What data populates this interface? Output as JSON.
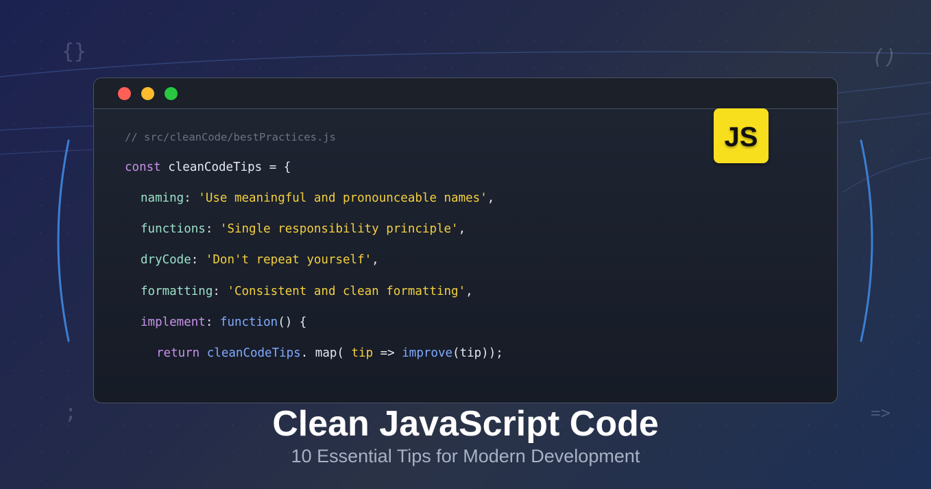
{
  "decorations": {
    "braces": "{}",
    "parens": "()",
    "semicolon": ";",
    "arrow": "=>"
  },
  "window": {
    "controls": [
      "close",
      "minimize",
      "maximize"
    ],
    "badge": "JS",
    "code": {
      "comment": "// src/cleanCode/bestPractices.js",
      "line1": {
        "kw": "const",
        "rest": " cleanCodeTips = {"
      },
      "naming": {
        "key": "naming",
        "sep": ": ",
        "value": "'Use meaningful and pronounceable names'",
        "end": ","
      },
      "functions": {
        "key": "functions",
        "sep": ": ",
        "value": "'Single responsibility principle'",
        "end": ","
      },
      "dryCode": {
        "key": "dryCode",
        "sep": ": ",
        "value": "'Don't repeat yourself'",
        "end": ","
      },
      "formatting": {
        "key": "formatting",
        "sep": ": ",
        "value": "'Consistent and clean formatting'",
        "end": ","
      },
      "implement": {
        "key": "implement",
        "sep": ": ",
        "fn": "function",
        "end": "() {"
      },
      "returnLine": {
        "kw": "return",
        "obj": "cleanCodeTips",
        "dot": ". map( ",
        "param": "tip",
        "arrow": " => ",
        "call": "improve",
        "end": "(tip));"
      }
    }
  },
  "heading": {
    "title": "Clean JavaScript Code",
    "subtitle": "10 Essential Tips for Modern Development"
  },
  "colors": {
    "js_yellow": "#f7df1e",
    "string": "#f4d03f",
    "keyword": "#c792ea",
    "property": "#9de0c8",
    "function": "#82aaff"
  }
}
